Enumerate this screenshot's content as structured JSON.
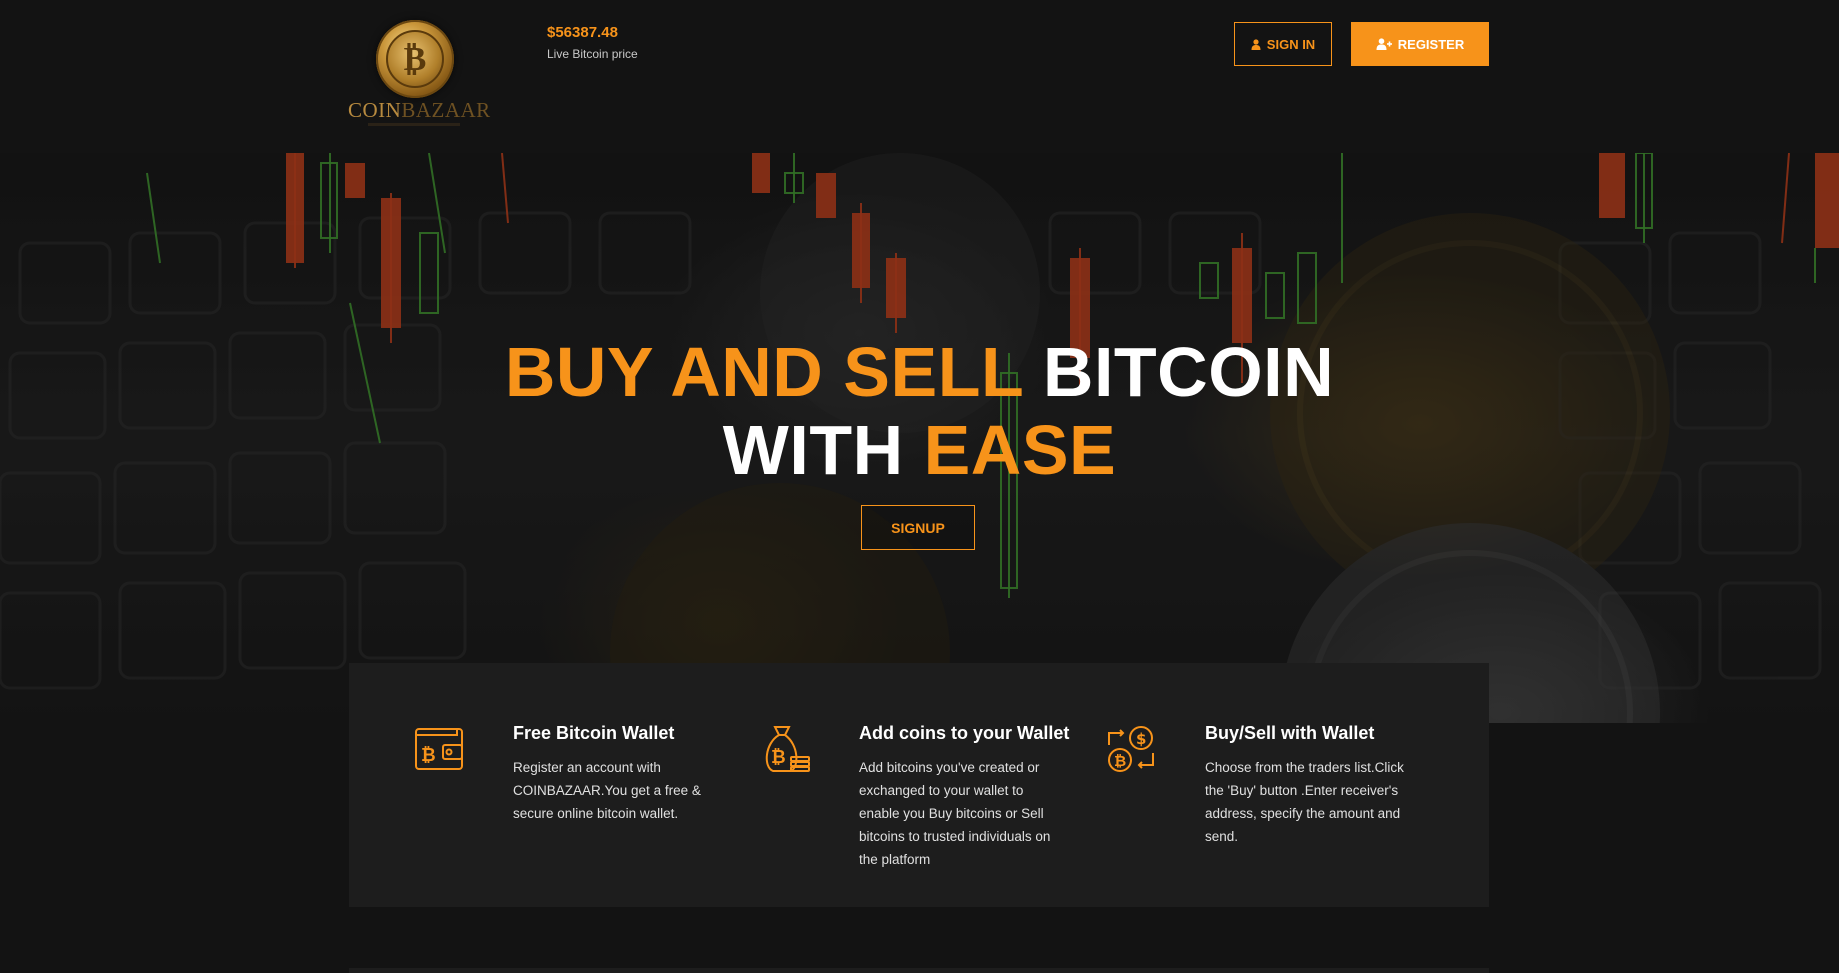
{
  "brand": {
    "logo_text_left": "COIN",
    "logo_text_right": "BAZAAR",
    "coin_symbol": "₿"
  },
  "price": {
    "value": "$56387.48",
    "label": "Live Bitcoin price"
  },
  "nav": {
    "signin_label": "SIGN IN",
    "signin_icon": "user-icon",
    "register_label": "REGISTER",
    "register_icon": "user-plus-icon"
  },
  "hero": {
    "line1_orange": "BUY AND SELL",
    "line1_white": "BITCOIN",
    "line2_white": "WITH",
    "line2_orange": "EASE",
    "signup_label": "SIGNUP"
  },
  "features": [
    {
      "icon": "bitcoin-wallet-icon",
      "title": "Free Bitcoin Wallet",
      "text": "Register an account with COINBAZAAR.You get a free & secure online bitcoin wallet."
    },
    {
      "icon": "bitcoin-moneybag-icon",
      "title": "Add coins to your Wallet",
      "text": "Add bitcoins you've created or exchanged to your wallet to enable you Buy bitcoins or Sell bitcoins to trusted individuals on the platform"
    },
    {
      "icon": "bitcoin-exchange-icon",
      "title": "Buy/Sell with Wallet",
      "text": "Choose from the traders list.Click the 'Buy' button .Enter receiver's address, specify the amount and send."
    }
  ],
  "colors": {
    "accent": "#f7931a",
    "background": "#131313",
    "panel": "#1d1d1d"
  }
}
